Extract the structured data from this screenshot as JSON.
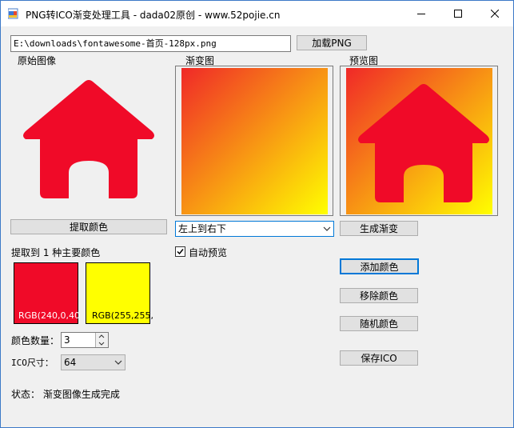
{
  "window": {
    "title": "PNG转ICO渐变处理工具 - dada02原创 - www.52pojie.cn"
  },
  "file": {
    "path": "E:\\downloads\\fontawesome-首页-128px.png",
    "load_button": "加载PNG"
  },
  "panels": {
    "original_label": "原始图像",
    "gradient_label": "渐变图",
    "preview_label": "预览图"
  },
  "gradient": {
    "start_color": "#F02828",
    "end_color": "#FFFF00"
  },
  "icon": {
    "name": "house-icon",
    "color": "#F00A28"
  },
  "buttons": {
    "extract_colors": "提取颜色",
    "generate_gradient": "生成渐变",
    "add_color": "添加颜色",
    "remove_color": "移除颜色",
    "random_color": "随机颜色",
    "save_ico": "保存ICO"
  },
  "direction": {
    "selected": "左上到右下"
  },
  "auto_preview": {
    "label": "自动预览",
    "checked": true
  },
  "extracted": {
    "summary": "提取到 1 种主要颜色",
    "colors": [
      {
        "label": "RGB(240,0,40",
        "hex": "#F00A28"
      },
      {
        "label": "RGB(255,255,",
        "hex": "#FFFF00"
      }
    ]
  },
  "color_count": {
    "label": "颜色数量：",
    "value": "3"
  },
  "ico_size": {
    "label": "ICO尺寸：",
    "value": "64"
  },
  "status": {
    "text": "状态：  渐变图像生成完成"
  }
}
